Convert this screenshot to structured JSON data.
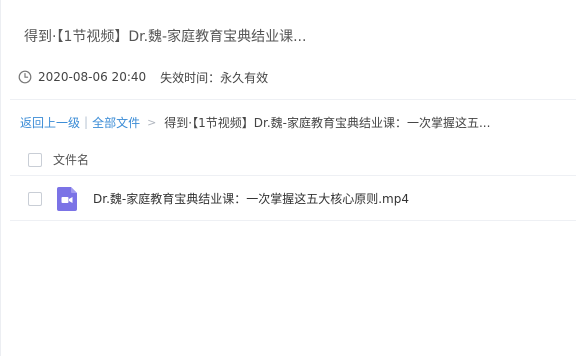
{
  "share": {
    "title": "得到·【1节视频】Dr.魏-家庭教育宝典结业课..."
  },
  "meta": {
    "clock_icon": "clock-icon",
    "date": "2020-08-06 20:40",
    "expire": "失效时间：永久有效"
  },
  "breadcrumb": {
    "back": "返回上一级",
    "separator": "|",
    "all_files": "全部文件",
    "arrow": ">",
    "current": "得到·【1节视频】Dr.魏-家庭教育宝典结业课：一次掌握这五..."
  },
  "table": {
    "header": "文件名",
    "rows": [
      {
        "name": "Dr.魏-家庭教育宝典结业课：一次掌握这五大核心原则.mp4",
        "icon": "video-file-icon",
        "icon_color": "#7b73e6"
      }
    ]
  },
  "colors": {
    "link": "#3b8cd6",
    "text": "#333333",
    "divider": "#eef0f4"
  }
}
